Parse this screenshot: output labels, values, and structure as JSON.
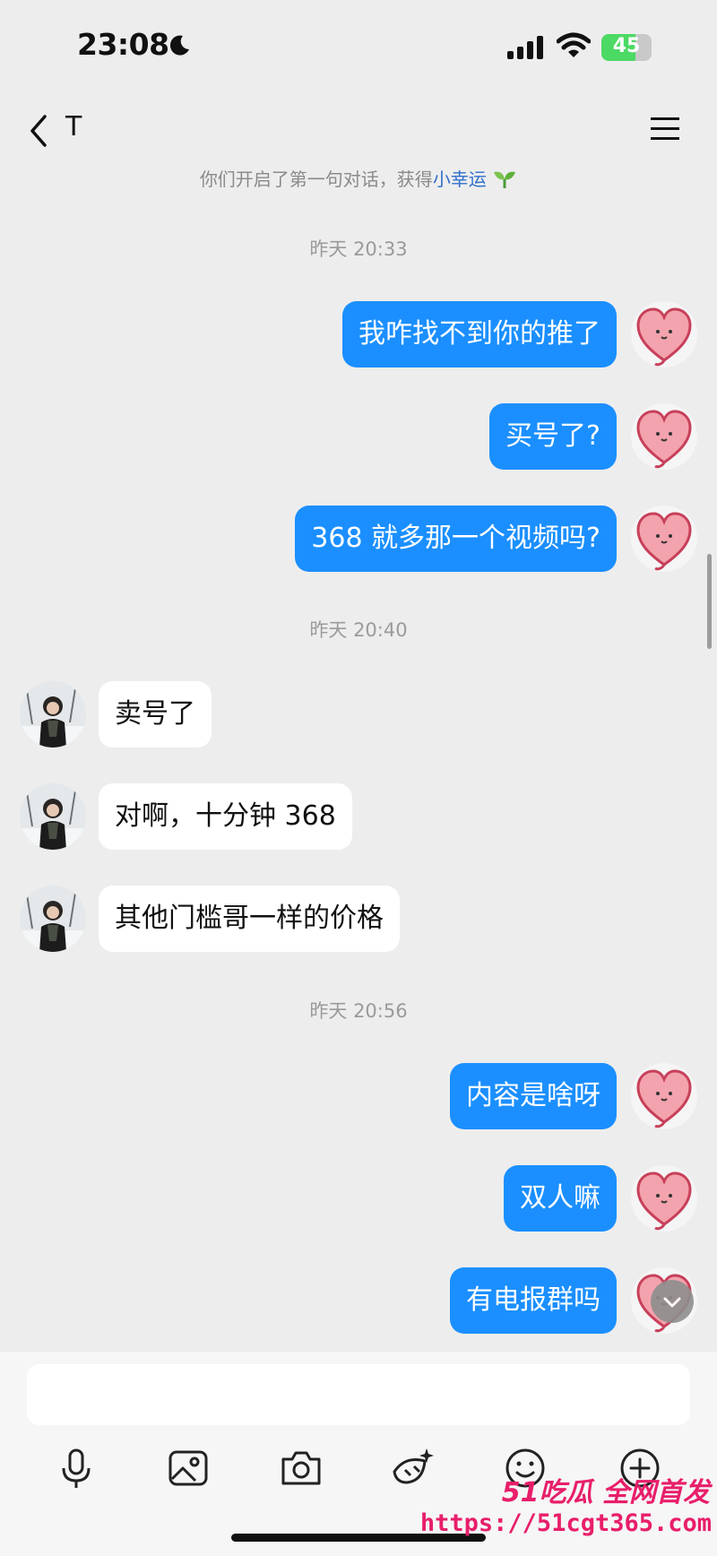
{
  "status": {
    "time": "23:08",
    "battery": "45"
  },
  "nav": {
    "contact": "T"
  },
  "system_note": {
    "prefix": "你们开启了第一句对话，获得",
    "highlight": "小幸运"
  },
  "timestamps": [
    "昨天 20:33",
    "昨天 20:40",
    "昨天 20:56"
  ],
  "messages": [
    {
      "from": "me",
      "text": "我咋找不到你的推了"
    },
    {
      "from": "me",
      "text": "买号了?"
    },
    {
      "from": "me",
      "text": "368 就多那一个视频吗?"
    },
    {
      "from": "her",
      "text": "卖号了"
    },
    {
      "from": "her",
      "text": "对啊，十分钟 368"
    },
    {
      "from": "her",
      "text": "其他门槛哥一样的价格"
    },
    {
      "from": "me",
      "text": "内容是啥呀"
    },
    {
      "from": "me",
      "text": "双人嘛"
    },
    {
      "from": "me",
      "text": "有电报群吗"
    }
  ],
  "input": {
    "value": ""
  },
  "toolbar": [
    "microphone-icon",
    "image-icon",
    "camera-icon",
    "magic-icon",
    "emoji-icon",
    "plus-icon"
  ],
  "watermark": {
    "line1": "51吃瓜 全网首发",
    "line2": "https://51cgt365.com"
  },
  "colors": {
    "outgoing_bubble": "#1b8fff",
    "incoming_bubble": "#ffffff",
    "background": "#ededed",
    "battery": "#4cd964",
    "watermark": "#e81e6a"
  }
}
